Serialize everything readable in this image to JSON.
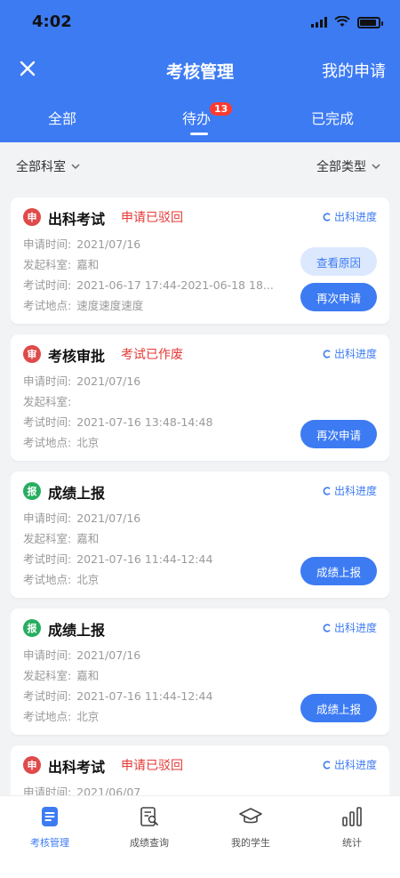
{
  "status_bar": {
    "time": "4:02"
  },
  "nav": {
    "title": "考核管理",
    "right_label": "我的申请"
  },
  "tabs": [
    {
      "label": "全部"
    },
    {
      "label": "待办",
      "badge": "13",
      "active": true
    },
    {
      "label": "已完成"
    }
  ],
  "filters": {
    "department": "全部科室",
    "type": "全部类型"
  },
  "labels": {
    "apply_time": "申请时间:",
    "department": "发起科室:",
    "exam_time": "考试时间:",
    "exam_place": "考试地点:"
  },
  "cards": [
    {
      "icon_char": "申",
      "icon_color": "#e04a4a",
      "title": "出科考试",
      "status": "申请已驳回",
      "progress_link": "出科进度",
      "apply_time": "2021/07/16",
      "department": "嘉和",
      "exam_time": "2021-06-17 17:44-2021-06-18 18...",
      "exam_place": "速度速度速度",
      "secondary_button": "查看原因",
      "primary_button": "再次申请"
    },
    {
      "icon_char": "审",
      "icon_color": "#e04a4a",
      "title": "考核审批",
      "status": "考试已作废",
      "progress_link": "出科进度",
      "apply_time": "2021/07/16",
      "department": "",
      "exam_time": "2021-07-16 13:48-14:48",
      "exam_place": "北京",
      "primary_button": "再次申请"
    },
    {
      "icon_char": "报",
      "icon_color": "#27ae60",
      "title": "成绩上报",
      "status": "",
      "progress_link": "出科进度",
      "apply_time": "2021/07/16",
      "department": "嘉和",
      "exam_time": "2021-07-16 11:44-12:44",
      "exam_place": "北京",
      "primary_button": "成绩上报"
    },
    {
      "icon_char": "报",
      "icon_color": "#27ae60",
      "title": "成绩上报",
      "status": "",
      "progress_link": "出科进度",
      "apply_time": "2021/07/16",
      "department": "嘉和",
      "exam_time": "2021-07-16 11:44-12:44",
      "exam_place": "北京",
      "primary_button": "成绩上报"
    },
    {
      "icon_char": "申",
      "icon_color": "#e04a4a",
      "title": "出科考试",
      "status": "申请已驳回",
      "progress_link": "出科进度",
      "apply_time": "2021/06/07"
    }
  ],
  "bottom_nav": [
    {
      "label": "考核管理",
      "icon": "document-icon",
      "active": true
    },
    {
      "label": "成绩查询",
      "icon": "search-doc-icon"
    },
    {
      "label": "我的学生",
      "icon": "graduation-cap-icon"
    },
    {
      "label": "统计",
      "icon": "bar-chart-icon"
    }
  ],
  "colors": {
    "primary": "#3d7bf3",
    "danger": "#e53935",
    "success": "#27ae60",
    "badge": "#ff3b30"
  }
}
